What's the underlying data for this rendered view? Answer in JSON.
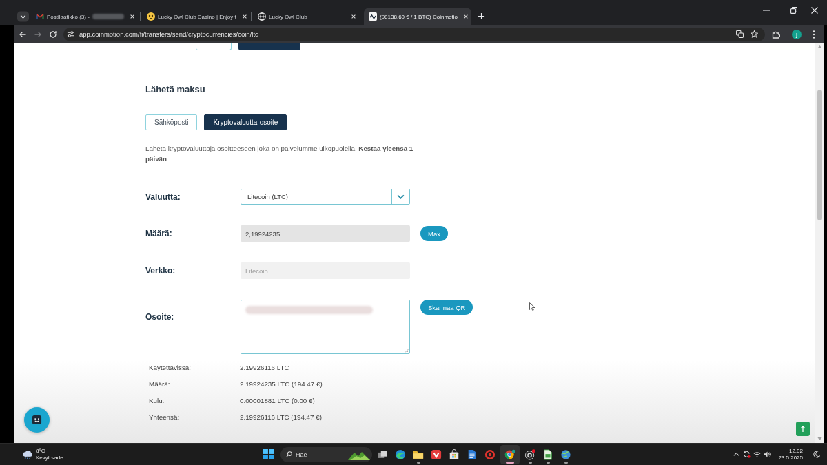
{
  "browser": {
    "tabs": [
      {
        "title": "Postilaatikko (3) -",
        "redacted": true,
        "selected": false
      },
      {
        "title": "Lucky Owl Club Casino | Enjoy t",
        "redacted": false,
        "selected": false
      },
      {
        "title": "Lucky Owl Club",
        "redacted": false,
        "selected": false
      },
      {
        "title": "(98138.60 € / 1 BTC) Coinmotio",
        "redacted": false,
        "selected": true
      }
    ],
    "url": "app.coinmotion.com/fi/transfers/send/cryptocurrencies/coin/ltc",
    "forward_disabled": true,
    "profile_initial": "j"
  },
  "page": {
    "transfer_type_buttons": [
      {
        "selected": false
      },
      {
        "selected": true
      }
    ],
    "heading": "Lähetä maksu",
    "methods": [
      {
        "label": "Sähköposti",
        "selected": false
      },
      {
        "label": "Kryptovaluutta-osoite",
        "selected": true
      }
    ],
    "description": "Lähetä kryptovaluuttoja osoitteeseen joka on palvelumme ulkopuolella. **Kestää yleensä 1 päivän**.",
    "fields": [
      {
        "kind": "select",
        "label": "Valuutta:",
        "value": "Litecoin (LTC)"
      },
      {
        "kind": "input",
        "label": "Määrä:",
        "value": "2,19924235",
        "disabled": false,
        "button": "Max"
      },
      {
        "kind": "input",
        "label": "Verkko:",
        "value": "Litecoin",
        "disabled": true
      },
      {
        "kind": "textarea",
        "label": "Osoite:",
        "redacted": true,
        "button": "Skannaa QR"
      }
    ],
    "summary": [
      {
        "label": "Käytettävissä:",
        "value": "2.19926116 LTC"
      },
      {
        "label": "Määrä:",
        "value": "2.19924235 LTC (194.47 €)"
      },
      {
        "label": "Kulu:",
        "value": "0.00001881 LTC (0.00 €)"
      },
      {
        "label": "Yhteensä:",
        "value": "2.19926116 LTC (194.47 €)"
      }
    ]
  },
  "taskbar": {
    "temperature": "8°C",
    "weather": "Kevyt sade",
    "search_placeholder": "Hae",
    "apps": [
      {
        "running": false,
        "selected": false
      },
      {
        "running": false,
        "selected": false
      },
      {
        "running": true,
        "selected": false
      },
      {
        "running": false,
        "selected": false
      },
      {
        "running": false,
        "selected": false
      },
      {
        "running": false,
        "selected": false
      },
      {
        "running": false,
        "selected": false
      },
      {
        "running": true,
        "selected": true
      },
      {
        "running": true,
        "selected": false
      },
      {
        "running": true,
        "selected": false
      },
      {
        "running": true,
        "selected": false
      }
    ],
    "time": "12.02",
    "date": "23.5.2025"
  }
}
